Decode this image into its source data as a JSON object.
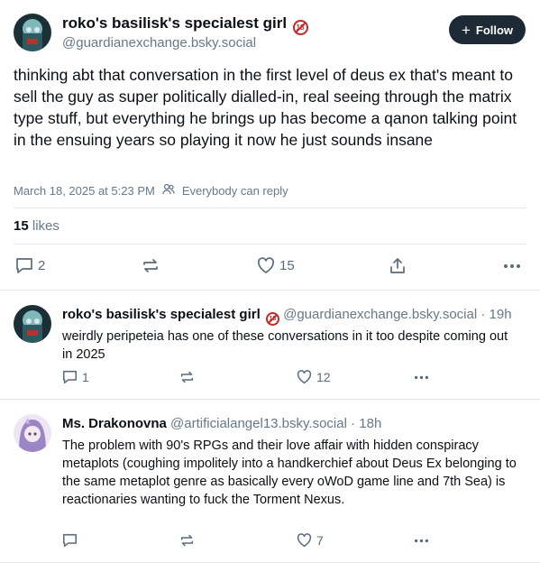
{
  "main_post": {
    "author_name": "roko's basilisk's specialest girl",
    "badge": "18",
    "handle": "@guardianexchange.bsky.social",
    "follow_label": "Follow",
    "text": "thinking abt that conversation in the first level of deus ex that's meant to sell the guy as super politically dialled-in, real seeing through the matrix type stuff, but everything he brings up has become a qanon talking point in the ensuing years so playing it now he just sounds insane",
    "timestamp": "March 18, 2025 at 5:23 PM",
    "reply_setting": "Everybody can reply",
    "likes_count": "15",
    "likes_label": "likes",
    "replies": "2",
    "like_action_count": "15"
  },
  "replies": [
    {
      "author_name": "roko's basilisk's specialest girl",
      "badge": "18",
      "handle": "@guardianexchange.bsky.social",
      "time": "· 19h",
      "text": "weirdly peripeteia has one of these conversations in it too despite coming out in 2025",
      "reply_count": "1",
      "like_count": "12"
    },
    {
      "author_name": "Ms. Drakonovna",
      "handle": "@artificialangel13.bsky.social",
      "time": "· 18h",
      "text": "The problem with 90's RPGs and their love affair with hidden conspiracy metaplots (coughing impolitely into a handkerchief about Deus Ex belonging to the same metaplot genre as basically every oWoD game line and 7th Sea) is reactionaries wanting to fuck the Torment Nexus.",
      "reply_count": "",
      "like_count": "7"
    }
  ],
  "colors": {
    "accent": "#1e2936",
    "muted": "#66788a",
    "badge": "#c62828",
    "divider": "#e3e8ed"
  },
  "icons": [
    "comment-icon",
    "repost-icon",
    "heart-icon",
    "share-icon",
    "more-icon",
    "plus-icon",
    "people-icon",
    "age-restricted-badge"
  ]
}
